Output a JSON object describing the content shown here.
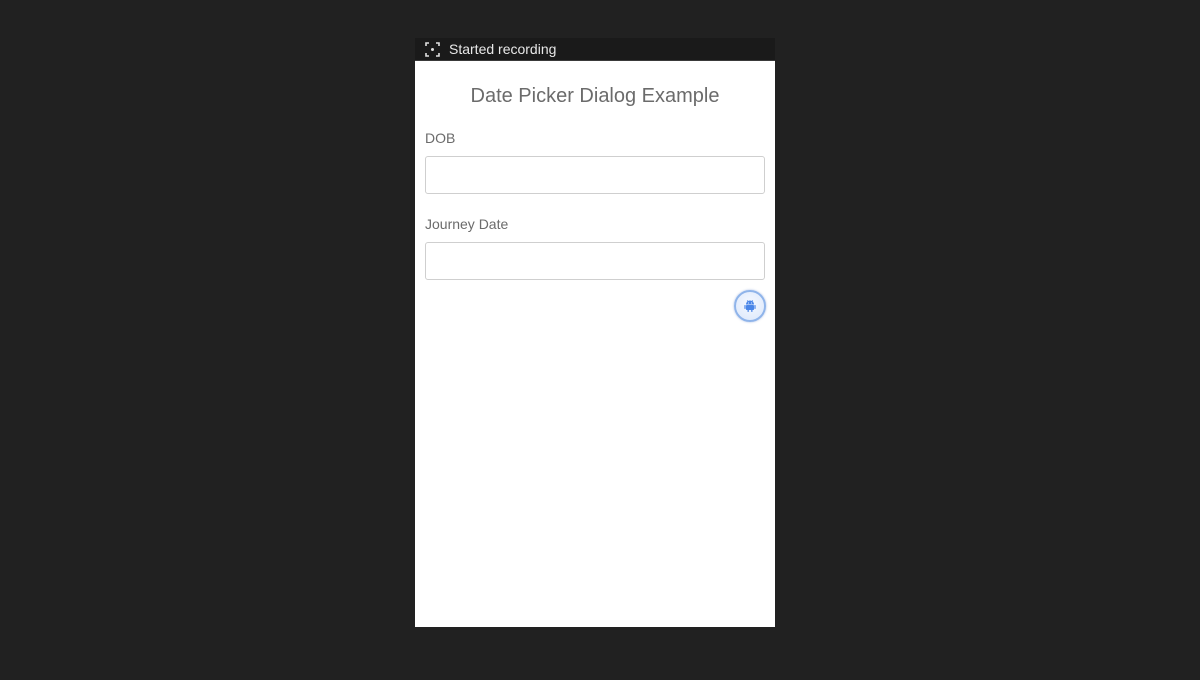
{
  "status_bar": {
    "text": "Started recording",
    "icon": "screen-record-icon"
  },
  "page": {
    "title": "Date Picker Dialog Example"
  },
  "form": {
    "dob": {
      "label": "DOB",
      "value": "",
      "placeholder": ""
    },
    "journey_date": {
      "label": "Journey Date",
      "value": "",
      "placeholder": ""
    }
  },
  "floating_button": {
    "icon": "android-icon"
  },
  "colors": {
    "background": "#212121",
    "status_bar": "#1a1a1a",
    "text_gray": "#6b6b6b",
    "accent_blue": "#4a86e8"
  }
}
